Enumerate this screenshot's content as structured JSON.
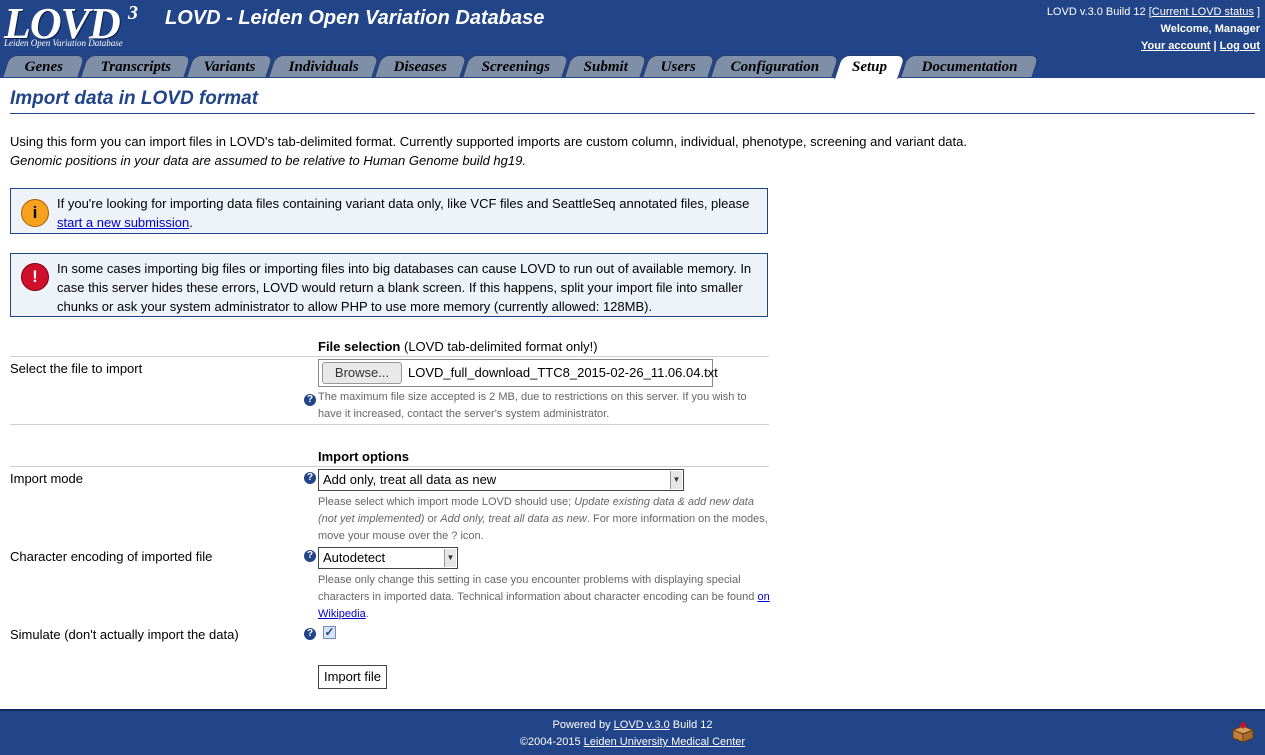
{
  "header": {
    "logo_text": "LOVD",
    "logo_sup": "3",
    "logo_sub": "Leiden Open Variation Database",
    "title": "LOVD - Leiden Open Variation Database",
    "version_prefix": "LOVD v.3.0 Build 12 [",
    "status_link": "Current LOVD status",
    "version_suffix": "]",
    "welcome": "Welcome, Manager",
    "account_link": "Your account",
    "separator": "|",
    "logout_link": "Log out"
  },
  "tabs": [
    {
      "label": "Genes"
    },
    {
      "label": "Transcripts"
    },
    {
      "label": "Variants"
    },
    {
      "label": "Individuals"
    },
    {
      "label": "Diseases"
    },
    {
      "label": "Screenings"
    },
    {
      "label": "Submit"
    },
    {
      "label": "Users"
    },
    {
      "label": "Configuration"
    },
    {
      "label": "Setup"
    },
    {
      "label": "Documentation"
    }
  ],
  "active_tab": "Setup",
  "page": {
    "title": "Import data in LOVD format",
    "intro_line1": "Using this form you can import files in LOVD's tab-delimited format. Currently supported imports are custom column, individual, phenotype, screening and variant data.",
    "intro_line2": "Genomic positions in your data are assumed to be relative to Human Genome build hg19."
  },
  "messages": {
    "info_text": "If you're looking for importing data files containing variant data only, like VCF files and SeattleSeq annotated files, please",
    "info_link": "start a new submission",
    "info_end": ".",
    "warn_text": "In some cases importing big files or importing files into big databases can cause LOVD to run out of available memory. In case this server hides these errors, LOVD would return a blank screen. If this happens, split your import file into smaller chunks or ask your system administrator to allow PHP to use more memory (currently allowed: 128MB)."
  },
  "form": {
    "file_section_title": "File selection",
    "file_section_note": "(LOVD tab-delimited format only!)",
    "file_label": "Select the file to import",
    "browse_label": "Browse...",
    "file_name": "LOVD_full_download_TTC8_2015-02-26_11.06.04.txt",
    "file_note": "The maximum file size accepted is 2 MB, due to restrictions on this server. If you wish to have it increased, contact the server's system administrator.",
    "options_title": "Import options",
    "mode_label": "Import mode",
    "mode_value": "Add only, treat all data as new",
    "mode_note_1": "Please select which import mode LOVD should use;",
    "mode_note_opt1": "Update existing data & add new data (not yet implemented)",
    "mode_note_or": "or",
    "mode_note_opt2": "Add only, treat all data as new",
    "mode_note_2": ". For more information on the modes, move your mouse over the ? icon.",
    "encoding_label": "Character encoding of imported file",
    "encoding_value": "Autodetect",
    "encoding_note": "Please only change this setting in case you encounter problems with displaying special characters in imported data. Technical information about character encoding can be found",
    "encoding_link": "on Wikipedia",
    "encoding_end": ".",
    "simulate_label": "Simulate (don't actually import the data)",
    "simulate_checked": true,
    "help_glyph": "?",
    "submit_label": "Import file"
  },
  "footer": {
    "powered_prefix": "Powered by",
    "powered_link": "LOVD v.3.0",
    "powered_suffix": "Build 12",
    "copyright_prefix": "©2004-2015",
    "copyright_link": "Leiden University Medical Center"
  },
  "colors": {
    "brand": "#224488",
    "info_icon": "#f6a21e",
    "warn_icon": "#d0102a"
  }
}
